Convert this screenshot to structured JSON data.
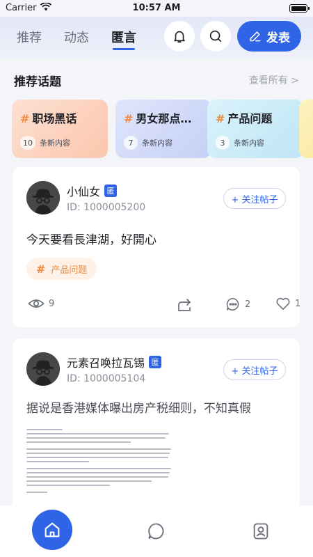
{
  "status_bar": {
    "carrier": "Carrier",
    "time": "10:57 AM"
  },
  "header": {
    "tabs": [
      {
        "label": "推荐",
        "active": false
      },
      {
        "label": "动态",
        "active": false
      },
      {
        "label": "匿言",
        "active": true
      }
    ],
    "publish_label": "发表"
  },
  "topics_section": {
    "title": "推荐话题",
    "see_all": "查看所有 >",
    "items": [
      {
        "hash": "#",
        "title": "职场黑话",
        "count": "10",
        "suffix": "条新内容"
      },
      {
        "hash": "#",
        "title": "男女那点…",
        "count": "7",
        "suffix": "条新内容"
      },
      {
        "hash": "#",
        "title": "产品问题",
        "count": "3",
        "suffix": "条新内容"
      }
    ]
  },
  "posts": [
    {
      "user_name": "小仙女",
      "badge": "匿",
      "user_id": "ID: 1000005200",
      "follow_label": "+ 关注帖子",
      "text": "今天要看長津湖，好開心",
      "tag_hash": "#",
      "tag": "产品问题",
      "views": "9",
      "comments": "2",
      "likes": "1"
    },
    {
      "user_name": "元素召唤拉瓦锡",
      "badge": "匿",
      "user_id": "ID: 1000005104",
      "follow_label": "+ 关注帖子",
      "text": "据说是香港媒体曝出房产税细则，不知真假"
    }
  ],
  "colors": {
    "accent": "#2f64e6",
    "tag_orange": "#f08a3c",
    "background": "#f4f5f9"
  },
  "icons": {
    "header": [
      "bell-icon",
      "search-icon",
      "edit-icon"
    ],
    "post_actions": [
      "eye-icon",
      "share-icon",
      "comment-icon",
      "heart-icon"
    ],
    "bottom_nav": [
      "home-icon",
      "chat-icon",
      "profile-icon"
    ]
  }
}
